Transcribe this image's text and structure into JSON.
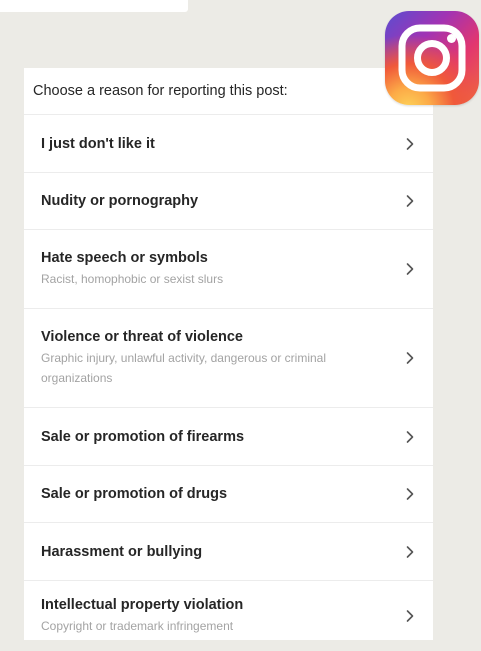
{
  "header": {
    "prompt": "Choose a reason for reporting this post:"
  },
  "logo": {
    "icon": "instagram-logo",
    "colors": [
      "#5a4dd1",
      "#a233b3",
      "#e2366f",
      "#f06a3c",
      "#fdd45a"
    ]
  },
  "reasons": [
    {
      "title": "I just don't like it",
      "subtitle": ""
    },
    {
      "title": "Nudity or pornography",
      "subtitle": ""
    },
    {
      "title": "Hate speech or symbols",
      "subtitle": "Racist, homophobic or sexist slurs"
    },
    {
      "title": "Violence or threat of violence",
      "subtitle": "Graphic injury, unlawful activity, dangerous or criminal organizations"
    },
    {
      "title": "Sale or promotion of firearms",
      "subtitle": ""
    },
    {
      "title": "Sale or promotion of drugs",
      "subtitle": ""
    },
    {
      "title": "Harassment or bullying",
      "subtitle": ""
    },
    {
      "title": "Intellectual property violation",
      "subtitle": "Copyright or trademark infringement"
    }
  ],
  "chevron_icon": "chevron-right-icon"
}
